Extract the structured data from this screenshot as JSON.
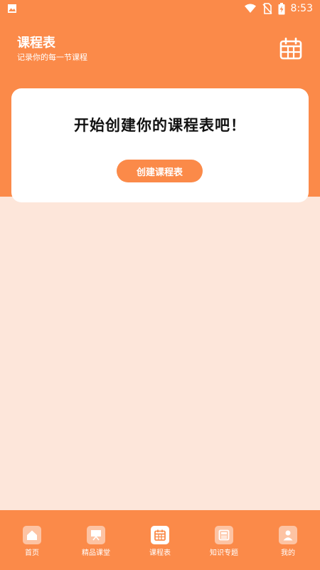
{
  "status_bar": {
    "time": "8:53",
    "icons": [
      "image-icon",
      "wifi-icon",
      "no-sim-icon",
      "battery-charging-icon"
    ]
  },
  "header": {
    "title": "课程表",
    "subtitle": "记录你的每一节课程",
    "action_icon": "calendar-icon"
  },
  "card": {
    "title": "开始创建你的课程表吧！",
    "button_label": "创建课程表"
  },
  "nav": {
    "items": [
      {
        "label": "首页",
        "icon": "home-icon"
      },
      {
        "label": "精品课堂",
        "icon": "classroom-icon"
      },
      {
        "label": "课程表",
        "icon": "calendar-icon"
      },
      {
        "label": "知识专题",
        "icon": "topic-icon"
      },
      {
        "label": "我的",
        "icon": "profile-icon"
      }
    ],
    "active_index": 2
  },
  "colors": {
    "primary": "#fb8a49",
    "background": "#fde6da",
    "icon_inactive": "#fdc3a3",
    "white": "#ffffff"
  }
}
